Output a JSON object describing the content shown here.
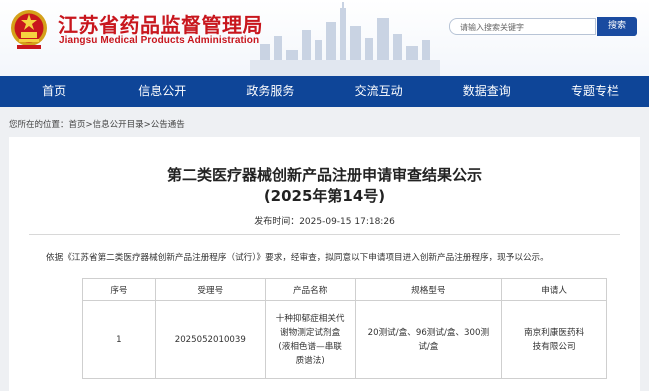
{
  "header": {
    "title_cn": "江苏省药品监督管理局",
    "title_en": "Jiangsu Medical Products Administration",
    "emblem_icon": "national-emblem-icon",
    "search_placeholder": "请输入搜索关键字",
    "search_button": "搜索",
    "brand_color": "#c8161d",
    "nav_color": "#0e4598"
  },
  "nav": {
    "items": [
      {
        "label": "首页"
      },
      {
        "label": "信息公开"
      },
      {
        "label": "政务服务"
      },
      {
        "label": "交流互动"
      },
      {
        "label": "数据查询"
      },
      {
        "label": "专题专栏"
      }
    ]
  },
  "breadcrumb": {
    "prefix": "您所在的位置：",
    "items": [
      "首页",
      "信息公开目录",
      "公告通告"
    ],
    "sep": ">"
  },
  "article": {
    "title_line1": "第二类医疗器械创新产品注册申请审查结果公示",
    "title_line2": "(2025年第14号)",
    "publish_label": "发布时间：",
    "publish_time": "2025-09-15 17:18:26",
    "intro": "依据《江苏省第二类医疗器械创新产品注册程序（试行）》要求，经审查，拟同意以下申请项目进入创新产品注册程序，现予以公示。"
  },
  "table": {
    "headers": [
      "序号",
      "受理号",
      "产品名称",
      "规格型号",
      "申请人"
    ],
    "rows": [
      {
        "no": "1",
        "accept_no": "2025052010039",
        "name_lines": [
          "十种抑郁症相关代",
          "谢物测定试剂盒",
          "(液相色谱—串联",
          "质谱法)"
        ],
        "spec_lines": [
          "20测试/盒、96测试/盒、300测",
          "试/盒"
        ],
        "applicant_lines": [
          "南京利康医药科",
          "技有限公司"
        ]
      }
    ]
  }
}
